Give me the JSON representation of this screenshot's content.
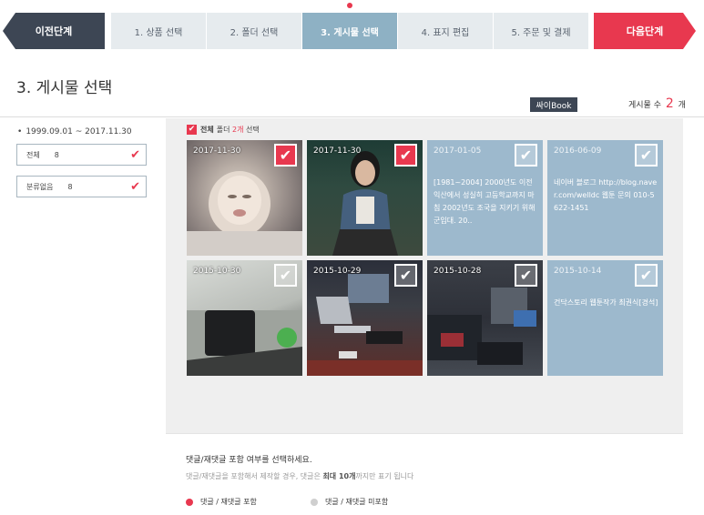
{
  "stepbar": {
    "prev_label": "이전단계",
    "next_label": "다음단계",
    "steps": [
      "1. 상품 선택",
      "2. 폴더 선택",
      "3. 게시물 선택",
      "4. 표지 편집",
      "5. 주문 및 결제"
    ],
    "active_step": 3
  },
  "page": {
    "title": "3. 게시물 선택",
    "ssibook_label": "싸이Book",
    "count_label": "게시물 수",
    "count_value": "2",
    "count_unit": "개"
  },
  "sidebar": {
    "date_range": "1999.09.01 ~ 2017.11.30",
    "filters": [
      {
        "label": "전체",
        "count": "8"
      },
      {
        "label": "분류없음",
        "count": "8"
      }
    ]
  },
  "selection": {
    "all_label": "전체",
    "folder_label": "폴더",
    "count": "2개",
    "suffix": "선택"
  },
  "posts": [
    {
      "date": "2017-11-30",
      "type": "photo",
      "checked": true,
      "body": ""
    },
    {
      "date": "2017-11-30",
      "type": "photo",
      "checked": true,
      "body": ""
    },
    {
      "date": "2017-01-05",
      "type": "text",
      "checked": false,
      "body": "[1981~2004] 2000년도 이전 익산에서 성실히 고등학교까지 마침 2002년도 조국을 지키기 위해 군입대. 20.."
    },
    {
      "date": "2016-06-09",
      "type": "text",
      "checked": false,
      "body": "네이버 블로그 http://blog.naver.com/welldc 웹툰 문의 010-5622-1451"
    },
    {
      "date": "2015-10-30",
      "type": "photo",
      "checked": false,
      "body": ""
    },
    {
      "date": "2015-10-29",
      "type": "photo",
      "checked": false,
      "body": ""
    },
    {
      "date": "2015-10-28",
      "type": "photo",
      "checked": false,
      "body": ""
    },
    {
      "date": "2015-10-14",
      "type": "text",
      "checked": false,
      "body": "건닥스토리 웹툰작가 최권식[경석]"
    }
  ],
  "comments": {
    "question": "댓글/재댓글 포함 여부를 선택하세요.",
    "note_prefix": "댓글/재댓글을 포함해서 제작할 경우, 댓글은",
    "note_bold": "최대 10개",
    "note_suffix": "까지만 표기 됩니다",
    "option_include": "댓글 / 재댓글 포함",
    "option_exclude": "댓글 / 재댓글 미포함"
  },
  "colors": {
    "accent": "#e8384f",
    "dark": "#3d4654",
    "active_step": "#8eb1c4",
    "text_tile": "#9db9cd"
  }
}
